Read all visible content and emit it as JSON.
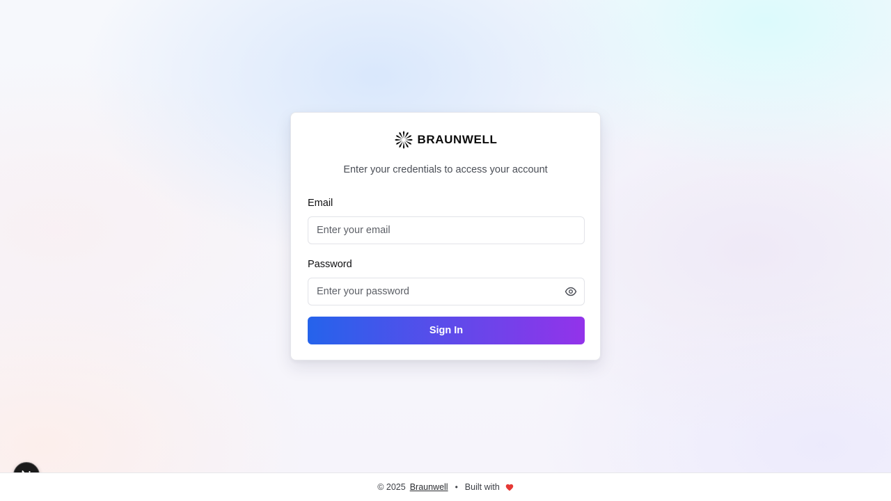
{
  "brand": {
    "name": "BRAUNWELL",
    "logo_icon": "starburst-logo-icon"
  },
  "login": {
    "subtitle": "Enter your credentials to access your account",
    "email": {
      "label": "Email",
      "placeholder": "Enter your email",
      "value": ""
    },
    "password": {
      "label": "Password",
      "placeholder": "Enter your password",
      "value": "",
      "toggle_icon": "eye-icon"
    },
    "submit_label": "Sign In"
  },
  "footer": {
    "copyright": "© 2025",
    "company_link": "Braunwell",
    "separator": "•",
    "built_with": "Built with",
    "heart_icon": "heart-icon"
  },
  "dev_badge": {
    "letter": "N",
    "icon": "nextjs-icon"
  },
  "colors": {
    "button_start": "#2563eb",
    "button_end": "#9333ea",
    "heart": "#e53935"
  }
}
